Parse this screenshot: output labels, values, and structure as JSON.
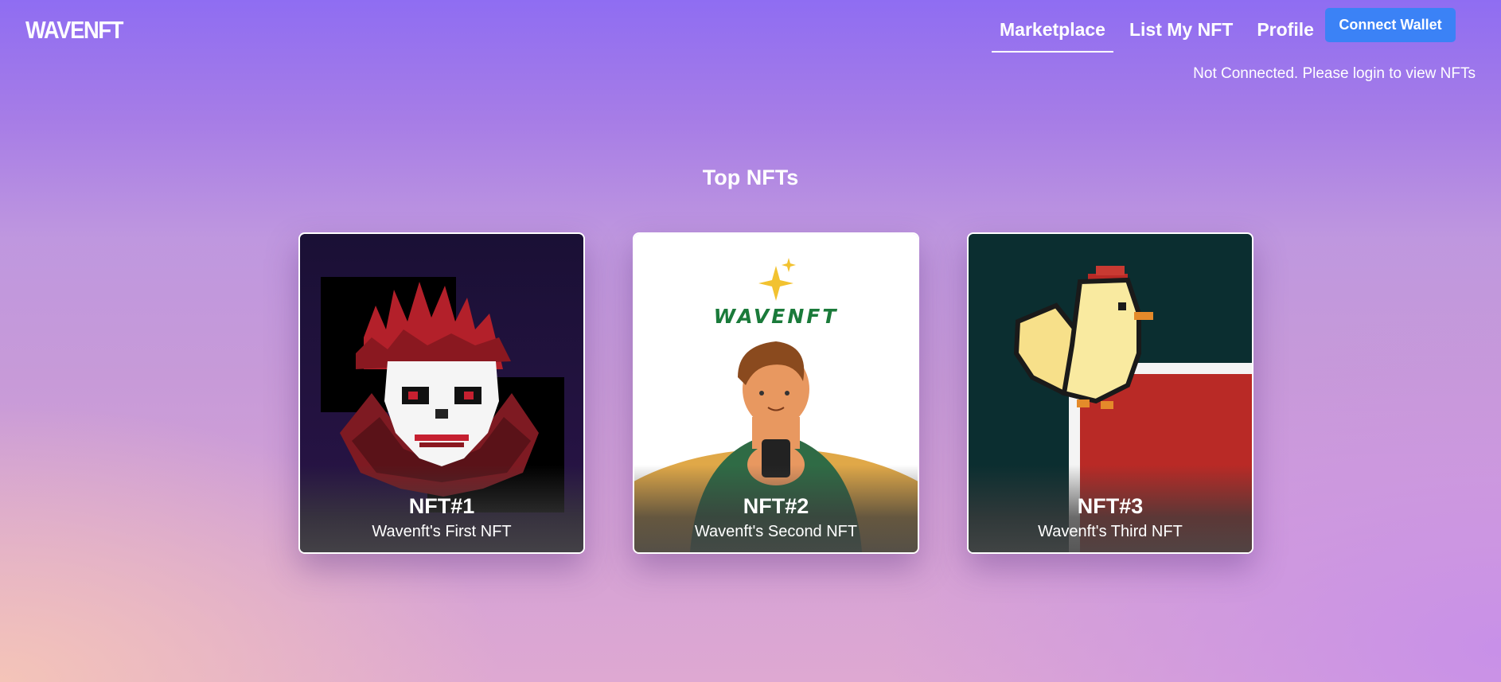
{
  "brand": {
    "logo": "WAVENFT"
  },
  "nav": {
    "items": [
      {
        "label": "Marketplace",
        "active": true
      },
      {
        "label": "List My NFT",
        "active": false
      },
      {
        "label": "Profile",
        "active": false
      }
    ],
    "connect_label": "Connect Wallet"
  },
  "status": "Not Connected. Please login to view NFTs",
  "section": {
    "title": "Top NFTs"
  },
  "cards": [
    {
      "name": "NFT#1",
      "description": "Wavenft's First NFT",
      "image": "pixel-clown"
    },
    {
      "name": "NFT#2",
      "description": "Wavenft's Second NFT",
      "image": "person-with-phone",
      "art_text": "WAVENFT"
    },
    {
      "name": "NFT#3",
      "description": "Wavenft's Third NFT",
      "image": "pixel-chicken"
    }
  ],
  "colors": {
    "accent": "#3b82f6",
    "text": "#ffffff"
  }
}
